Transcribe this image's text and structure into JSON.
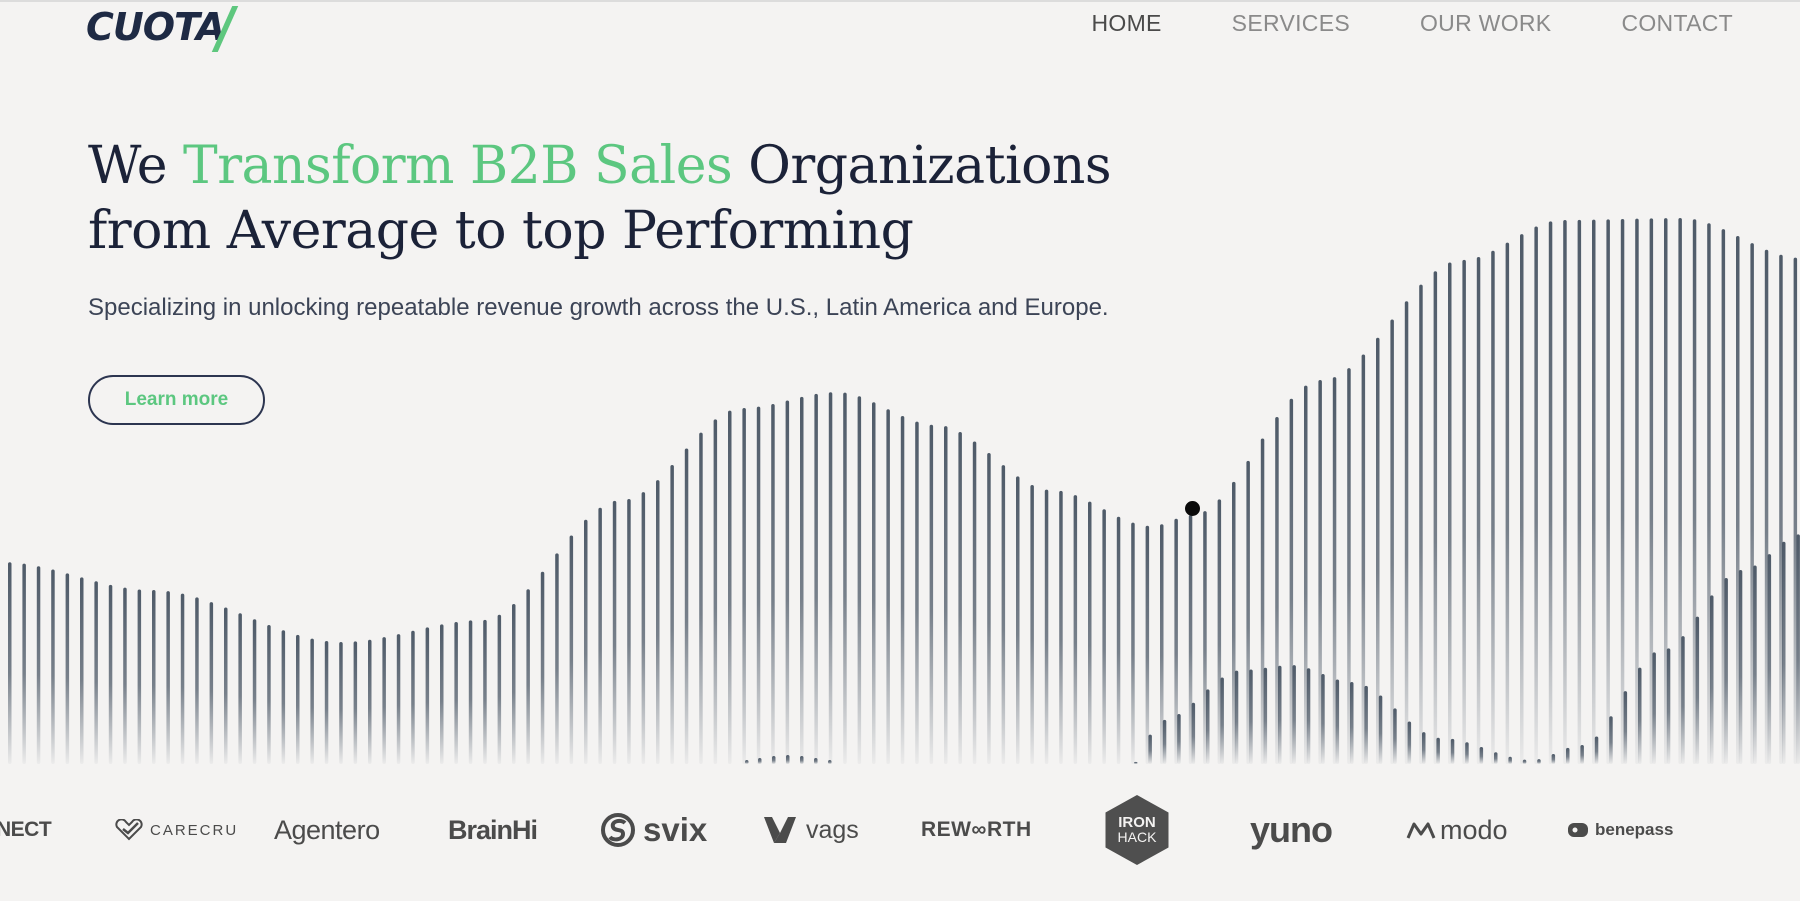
{
  "header": {
    "logo_text": "CUOTA",
    "nav": [
      {
        "label": "HOME"
      },
      {
        "label": "SERVICES"
      },
      {
        "label": "OUR WORK"
      },
      {
        "label": "CONTACT"
      }
    ],
    "active_nav": "HOME"
  },
  "hero": {
    "title_part1": "We ",
    "title_accent": "Transform B2B Sales",
    "title_part2": " Organizations",
    "title_line2": "from Average to top Performing",
    "subtitle": "Specializing in unlocking repeatable revenue growth across the U.S., Latin America and Europe.",
    "cta_label": "Learn more"
  },
  "client_logos": {
    "connect": "NECT",
    "carecru": "CARECRU",
    "agentero": "Agentero",
    "brainhi": "BrainHi",
    "svix": "svix",
    "vags": "vags",
    "reworth": "REW∞RTH",
    "ironhack_line1": "IRON",
    "ironhack_line2": "HACK",
    "yuno": "yuno",
    "modo": "modo",
    "benepass": "benepass"
  },
  "colors": {
    "accent": "#5cc780",
    "navy": "#1b2238",
    "background": "#f4f3f2",
    "wave_bars": "#4e5a68"
  }
}
